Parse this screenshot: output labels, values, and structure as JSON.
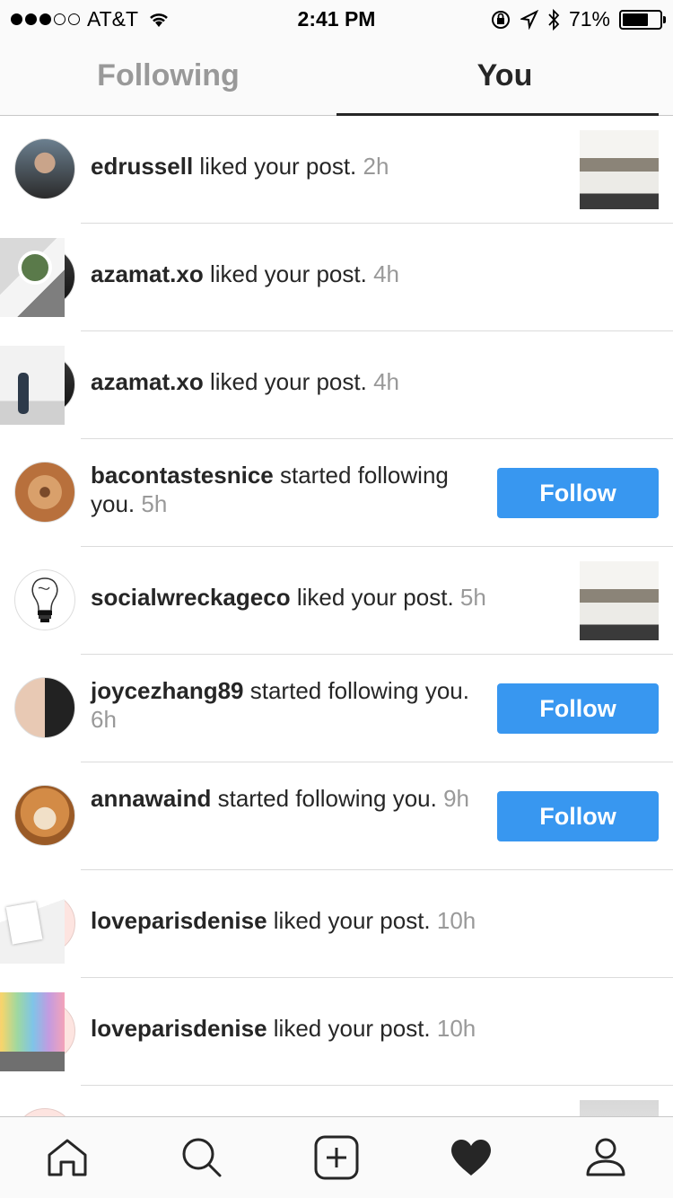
{
  "status_bar": {
    "carrier": "AT&T",
    "time": "2:41 PM",
    "battery": "71%",
    "battery_level": 0.71
  },
  "tabs": [
    {
      "label": "Following",
      "active": false
    },
    {
      "label": "You",
      "active": true
    }
  ],
  "activity": [
    {
      "user": "edrussell",
      "action": "liked your post.",
      "time": "2h",
      "avatar": "photo-man",
      "thumb": "basimo-sign"
    },
    {
      "user": "azamat.xo",
      "action": "liked your post.",
      "time": "4h",
      "avatar": "dark-selfie",
      "thumb": "desk-laptop"
    },
    {
      "user": "azamat.xo",
      "action": "liked your post.",
      "time": "4h",
      "avatar": "dark-selfie",
      "thumb": "girl-white-wall"
    },
    {
      "user": "bacontastesnice",
      "action": "started following you.",
      "time": "5h",
      "avatar": "bacon",
      "button": "Follow"
    },
    {
      "user": "socialwreckageco",
      "action": "liked your post.",
      "time": "5h",
      "avatar": "lightbulb",
      "thumb": "basimo-sign"
    },
    {
      "user": "joycezhang89",
      "action": "started following you.",
      "time": "6h",
      "avatar": "joyce",
      "button": "Follow"
    },
    {
      "user": "annawaind",
      "action": "started following you.",
      "time": "9h",
      "avatar": "shiba-dog",
      "button": "Follow"
    },
    {
      "user": "loveparisdenise",
      "action": "liked your post.",
      "time": "10h",
      "avatar": "blank-pink",
      "thumb": "white-card"
    },
    {
      "user": "loveparisdenise",
      "action": "liked your post.",
      "time": "10h",
      "avatar": "blank-pink",
      "thumb": "rainbow-wall"
    }
  ],
  "bottom_nav": [
    {
      "icon": "home-icon"
    },
    {
      "icon": "search-icon"
    },
    {
      "icon": "add-post-icon"
    },
    {
      "icon": "heart-icon",
      "active": true
    },
    {
      "icon": "profile-icon"
    }
  ],
  "colors": {
    "accent": "#3897f0",
    "text": "#262626",
    "muted": "#999999",
    "divider": "#dbdbdb"
  }
}
